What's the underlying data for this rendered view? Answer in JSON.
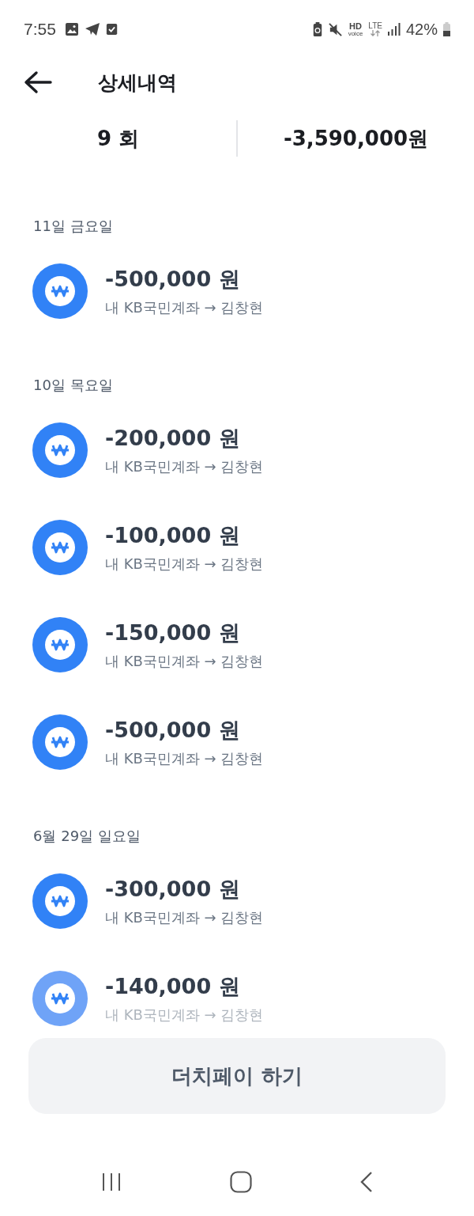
{
  "status_bar": {
    "time": "7:55",
    "hd": "HD",
    "voice": "voice",
    "network": "LTE",
    "battery": "42%"
  },
  "header": {
    "title": "상세내역"
  },
  "summary": {
    "count": "9 회",
    "total": "-3,590,000원"
  },
  "sections": [
    {
      "date": "11일 금요일",
      "items": [
        {
          "amount": "-500,000 원",
          "route": "내 KB국민계좌 → 김창현",
          "faded": false
        }
      ]
    },
    {
      "date": "10일 목요일",
      "items": [
        {
          "amount": "-200,000 원",
          "route": "내 KB국민계좌 → 김창현",
          "faded": false
        },
        {
          "amount": "-100,000 원",
          "route": "내 KB국민계좌 → 김창현",
          "faded": false
        },
        {
          "amount": "-150,000 원",
          "route": "내 KB국민계좌 → 김창현",
          "faded": false
        },
        {
          "amount": "-500,000 원",
          "route": "내 KB국민계좌 → 김창현",
          "faded": false
        }
      ]
    },
    {
      "date": "6월 29일 일요일",
      "items": [
        {
          "amount": "-300,000 원",
          "route": "내 KB국민계좌 → 김창현",
          "faded": false
        },
        {
          "amount": "-140,000 원",
          "route": "내 KB국민계좌 → 김창현",
          "faded": true
        }
      ]
    }
  ],
  "action_button": {
    "label": "더치페이 하기"
  }
}
